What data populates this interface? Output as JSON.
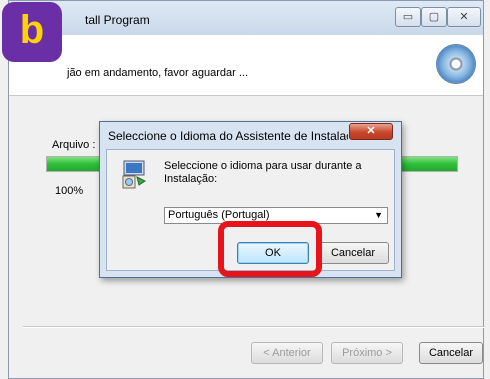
{
  "window": {
    "title": "Install Program",
    "title_visible": "tall Program",
    "controls": {
      "minimize": "▭",
      "maximize": "▢",
      "close": "✕"
    }
  },
  "header": {
    "status_text": "jão em andamento, favor aguardar ..."
  },
  "progress": {
    "label": "Arquivo :",
    "percent_text": "100%",
    "fraction": 1.0
  },
  "footer": {
    "back_label": "< Anterior",
    "next_label": "Próximo >",
    "cancel_label": "Cancelar"
  },
  "dialog": {
    "title": "Seleccione o Idioma do Assistente de Instalaç...",
    "message": "Seleccione o idioma para usar durante a Instalação:",
    "language_selected": "Português (Portugal)",
    "ok_label": "OK",
    "cancel_label": "Cancelar",
    "close_glyph": "✕"
  },
  "annotation": {
    "badge_letter": "b"
  },
  "colors": {
    "highlight": "#e8141c",
    "badge_bg": "#6a2fa6",
    "badge_text": "#ffd200",
    "progress": "#2fbf3a"
  },
  "icons": [
    "cd-icon",
    "installer-icon",
    "dropdown-arrow-icon",
    "close-icon"
  ]
}
